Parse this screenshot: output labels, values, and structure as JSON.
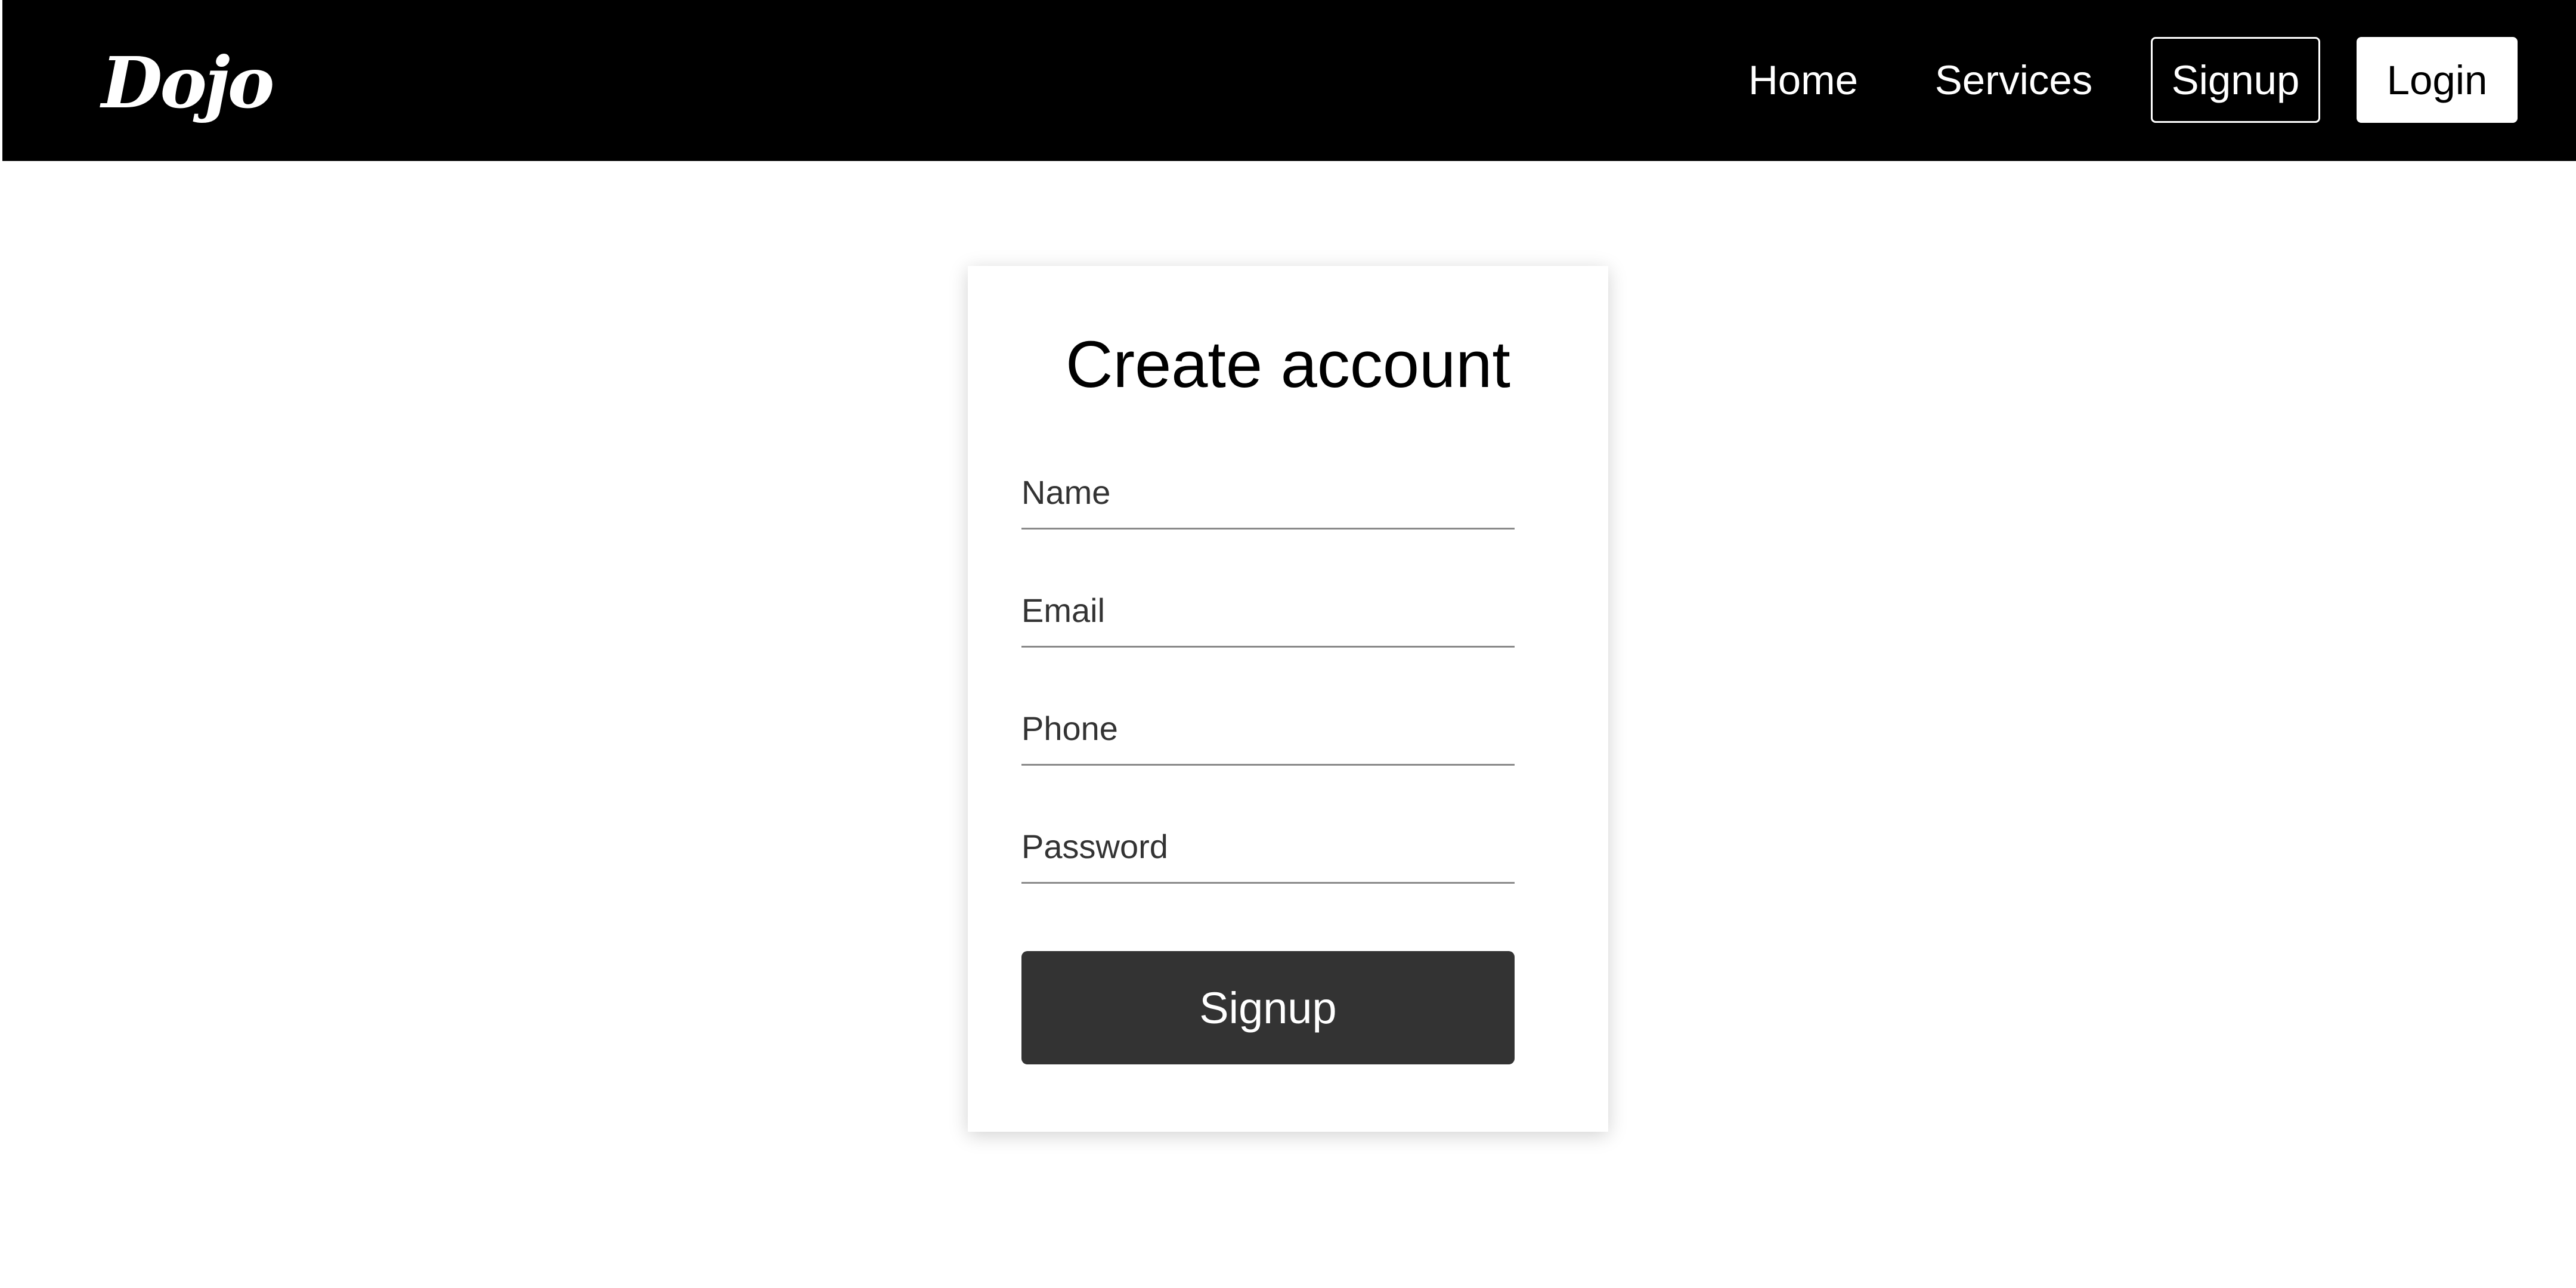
{
  "header": {
    "logo_text": "Dojo",
    "nav": {
      "home": "Home",
      "services": "Services",
      "signup": "Signup",
      "login": "Login"
    }
  },
  "form": {
    "title": "Create account",
    "fields": [
      {
        "label": "Name",
        "value": ""
      },
      {
        "label": "Email",
        "value": ""
      },
      {
        "label": "Phone",
        "value": ""
      },
      {
        "label": "Password",
        "value": ""
      }
    ],
    "submit_label": "Signup"
  },
  "colors": {
    "navbar_bg": "#000000",
    "submit_bg": "#333333",
    "field_line": "#8a8a8a"
  }
}
